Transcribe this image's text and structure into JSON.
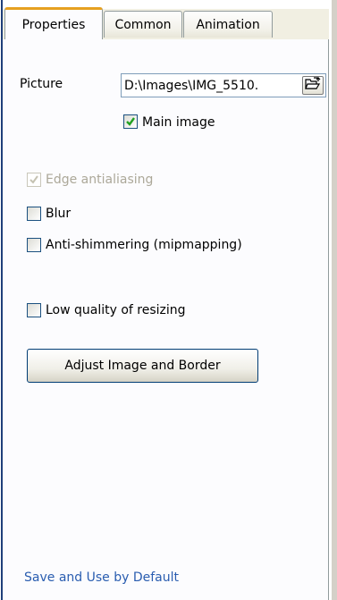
{
  "tabs": [
    {
      "label": "Properties",
      "active": true
    },
    {
      "label": "Common",
      "active": false
    },
    {
      "label": "Animation",
      "active": false
    }
  ],
  "picture": {
    "label": "Picture",
    "value": "D:\\Images\\IMG_5510.",
    "browse_icon": "folder-open-icon"
  },
  "options": {
    "main_image": {
      "label": "Main image",
      "checked": true,
      "enabled": true
    },
    "edge_antialiasing": {
      "label": "Edge antialiasing",
      "checked": true,
      "enabled": false
    },
    "blur": {
      "label": "Blur",
      "checked": false,
      "enabled": true
    },
    "anti_shimmering": {
      "label": "Anti-shimmering (mipmapping)",
      "checked": false,
      "enabled": true
    },
    "low_quality": {
      "label": "Low quality of resizing",
      "checked": false,
      "enabled": true
    }
  },
  "adjust_button": {
    "label": "Adjust Image and Border"
  },
  "footer_link": {
    "label": "Save and Use by Default"
  },
  "colors": {
    "link": "#2a5db0",
    "check_green": "#21a121",
    "disabled_text": "#aca899",
    "active_tab_accent": "#e6a020"
  }
}
